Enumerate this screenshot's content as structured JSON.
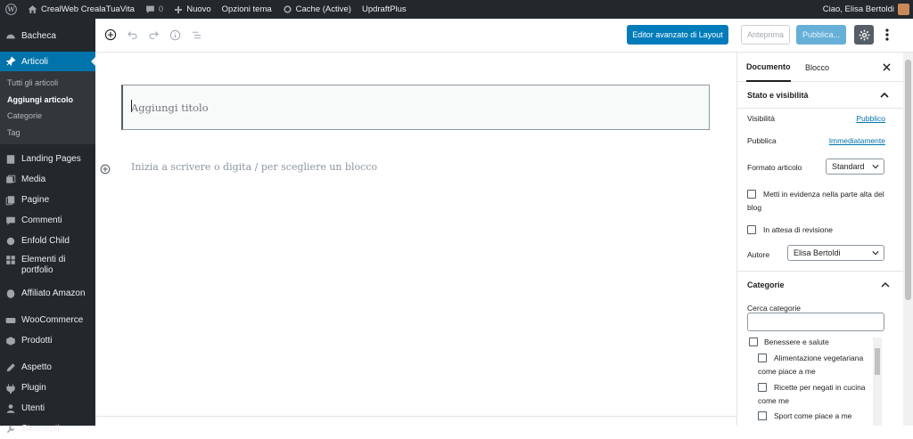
{
  "adminbar": {
    "site_name": "CrealWeb CrealaTuaVita",
    "comments_count": "0",
    "new_label": "Nuovo",
    "theme_options": "Opzioni tema",
    "cache_label": "Cache (Active)",
    "updraft": "UpdraftPlus",
    "greeting": "Ciao, Elisa Bertoldi"
  },
  "sidebar": {
    "items": [
      {
        "label": "Bacheca",
        "icon": "dashboard-icon"
      },
      {
        "label": "Articoli",
        "icon": "pin-icon"
      },
      {
        "label": "Landing Pages",
        "icon": "landing-icon"
      },
      {
        "label": "Media",
        "icon": "media-icon"
      },
      {
        "label": "Pagine",
        "icon": "pages-icon"
      },
      {
        "label": "Commenti",
        "icon": "comments-icon"
      },
      {
        "label": "Enfold Child",
        "icon": "theme-icon"
      },
      {
        "label": "Elementi di portfolio",
        "icon": "portfolio-icon"
      },
      {
        "label": "Affiliato Amazon",
        "icon": "amazon-icon"
      },
      {
        "label": "WooCommerce",
        "icon": "woocommerce-icon"
      },
      {
        "label": "Prodotti",
        "icon": "products-icon"
      },
      {
        "label": "Aspetto",
        "icon": "appearance-icon"
      },
      {
        "label": "Plugin",
        "icon": "plugin-icon"
      },
      {
        "label": "Utenti",
        "icon": "users-icon"
      },
      {
        "label": "Strumenti",
        "icon": "tools-icon"
      }
    ],
    "submenu": [
      "Tutti gli articoli",
      "Aggiungi articolo",
      "Categorie",
      "Tag"
    ]
  },
  "toolbar": {
    "layout_editor": "Editor avanzato di Layout",
    "preview": "Anteprima",
    "publish": "Pubblica..."
  },
  "editor": {
    "title_placeholder": "Aggiungi titolo",
    "block_placeholder": "Inizia a scrivere o digita / per scegliere un blocco"
  },
  "settings": {
    "tab_document": "Documento",
    "tab_block": "Blocco",
    "status_panel": "Stato e visibilità",
    "visibility_label": "Visibilità",
    "visibility_value": "Pubblico",
    "publish_label": "Pubblica",
    "publish_value": "Immediatamente",
    "format_label": "Formato articolo",
    "format_value": "Standard",
    "sticky_label": "Metti in evidenza nella parte alta del blog",
    "pending_label": "In attesa di revisione",
    "author_label": "Autore",
    "author_value": "Elisa Bertoldi",
    "categories_panel": "Categorie",
    "search_categories": "Cerca categorie",
    "categories": [
      "Benessere e salute",
      "Alimentazione vegetariana come piace a me",
      "Ricette per negati in cucina come me",
      "Sport come piace a me"
    ]
  }
}
